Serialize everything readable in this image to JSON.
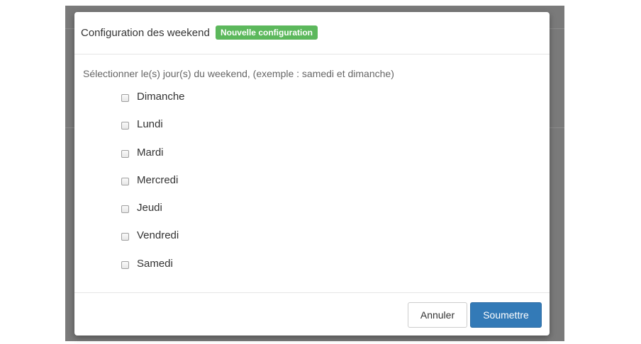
{
  "modal": {
    "title": "Configuration des weekend",
    "badge": "Nouvelle configuration",
    "instruction": "Sélectionner le(s) jour(s) du weekend, (exemple : samedi et dimanche)",
    "days": [
      {
        "label": "Dimanche",
        "checked": false
      },
      {
        "label": "Lundi",
        "checked": false
      },
      {
        "label": "Mardi",
        "checked": false
      },
      {
        "label": "Mercredi",
        "checked": false
      },
      {
        "label": "Jeudi",
        "checked": false
      },
      {
        "label": "Vendredi",
        "checked": false
      },
      {
        "label": "Samedi",
        "checked": false
      }
    ],
    "cancel_label": "Annuler",
    "submit_label": "Soumettre"
  },
  "colors": {
    "badge": "#5cb85c",
    "primary": "#337ab7",
    "backdrop": "#7a7a7a"
  }
}
